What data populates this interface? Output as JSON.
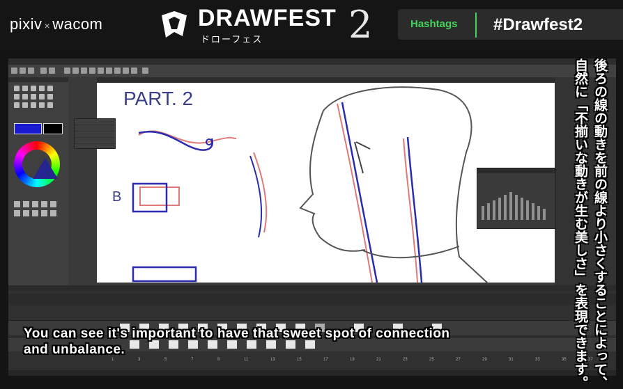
{
  "banner": {
    "brand_left": "pixiv",
    "brand_x": "×",
    "brand_right": "wacom",
    "event_title": "DRAWFEST",
    "event_kana": "ドローフェス",
    "event_number": "2",
    "hashtags_label": "Hashtags",
    "hashtag": "#Drawfest2"
  },
  "canvas": {
    "heading": "PART. 2",
    "label_b": "B"
  },
  "subtitle": {
    "line1": "You can see it's important to have that sweet spot of connection",
    "line2": "and unbalance."
  },
  "jp_caption": {
    "col1": "後ろの線の動きを前の線より小さくすることによって、",
    "col2": "自然に「不揃いな動きが生む美しさ」を表現できます。"
  },
  "colors": {
    "banner_bg": "#151515",
    "accent_green": "#46d35c",
    "main_color": "#1a1ad0"
  },
  "timeline": {
    "frame_numbers": [
      "1",
      "3",
      "5",
      "7",
      "9",
      "11",
      "13",
      "15",
      "17",
      "19",
      "21",
      "23",
      "25",
      "27",
      "29",
      "31",
      "33",
      "35",
      "37"
    ]
  }
}
